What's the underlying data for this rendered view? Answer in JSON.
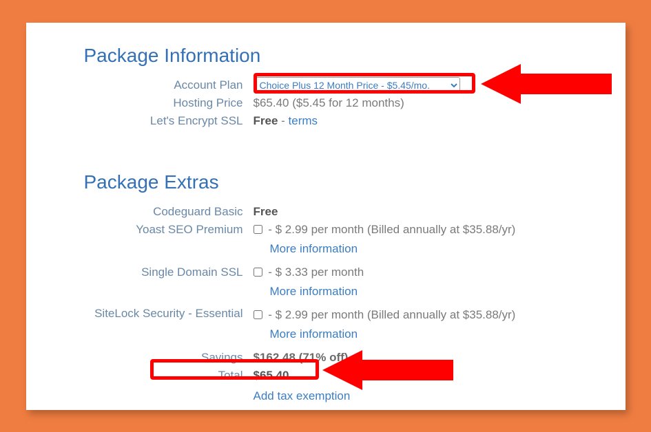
{
  "colors": {
    "accent_orange": "#ef7d41",
    "heading": "#3470b5",
    "label": "#6a88a6",
    "link": "#3b7dc2",
    "annotation": "#ff0000"
  },
  "package_info": {
    "title": "Package Information",
    "account_plan_label": "Account Plan",
    "account_plan_selected": "Choice Plus 12 Month Price - $5.45/mo.",
    "hosting_price_label": "Hosting Price",
    "hosting_price_value": "$65.40  ($5.45 for 12 months)",
    "ssl_label": "Let's Encrypt SSL",
    "ssl_value_free": "Free",
    "ssl_terms_link": "terms"
  },
  "package_extras": {
    "title": "Package Extras",
    "more_info": "More information",
    "items": [
      {
        "label": "Codeguard Basic",
        "free_text": "Free",
        "has_checkbox": false,
        "has_more_info": false
      },
      {
        "label": "Yoast SEO Premium",
        "price_text": "- $ 2.99 per month (Billed annually at $35.88/yr)",
        "has_checkbox": true,
        "has_more_info": true
      },
      {
        "label": "Single Domain SSL",
        "price_text": "- $ 3.33 per month",
        "has_checkbox": true,
        "has_more_info": true
      },
      {
        "label": "SiteLock Security - Essential",
        "price_text": "- $ 2.99 per month (Billed annually at $35.88/yr)",
        "has_checkbox": true,
        "has_more_info": true
      }
    ],
    "savings_label": "Savings",
    "savings_value": "$162.48 (71% off)",
    "total_label": "Total",
    "total_value": "$65.40",
    "tax_link": "Add tax exemption"
  }
}
